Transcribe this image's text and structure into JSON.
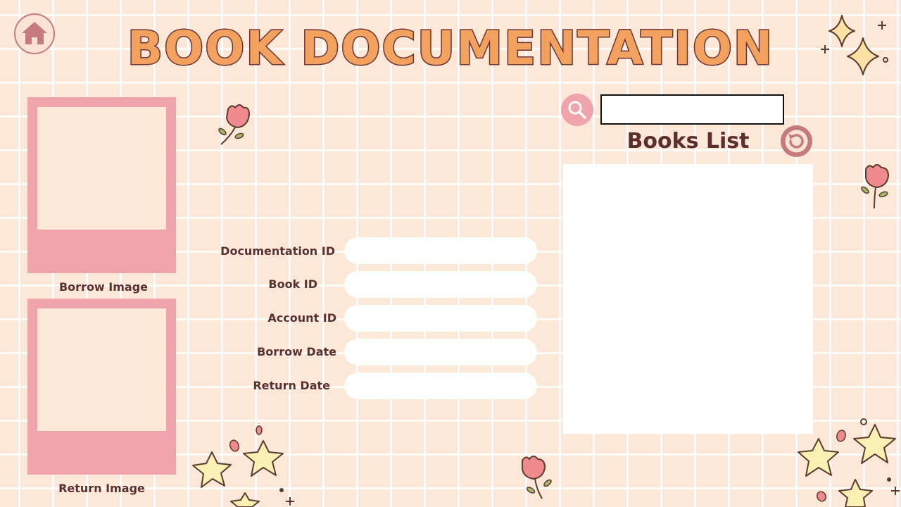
{
  "header": {
    "title": "BOOK DOCUMENTATION"
  },
  "images": {
    "borrow_label": "Borrow Image",
    "return_label": "Return Image"
  },
  "form": {
    "documentation_id": {
      "label": "Documentation ID",
      "value": ""
    },
    "book_id": {
      "label": "Book ID",
      "value": ""
    },
    "account_id": {
      "label": "Account ID",
      "value": ""
    },
    "borrow_date": {
      "label": "Borrow Date",
      "value": ""
    },
    "return_date": {
      "label": "Return Date",
      "value": ""
    }
  },
  "books_panel": {
    "title": "Books List",
    "search_value": ""
  },
  "icons": {
    "home": "home-icon",
    "search": "search-icon",
    "refresh": "refresh-icon"
  },
  "colors": {
    "background": "#fde8d7",
    "title_fill": "#f2a15f",
    "title_outline": "#6b3434",
    "frame_pink": "#efa3aa",
    "text": "#5c2e2e",
    "accent_rose": "#c57b7b"
  }
}
